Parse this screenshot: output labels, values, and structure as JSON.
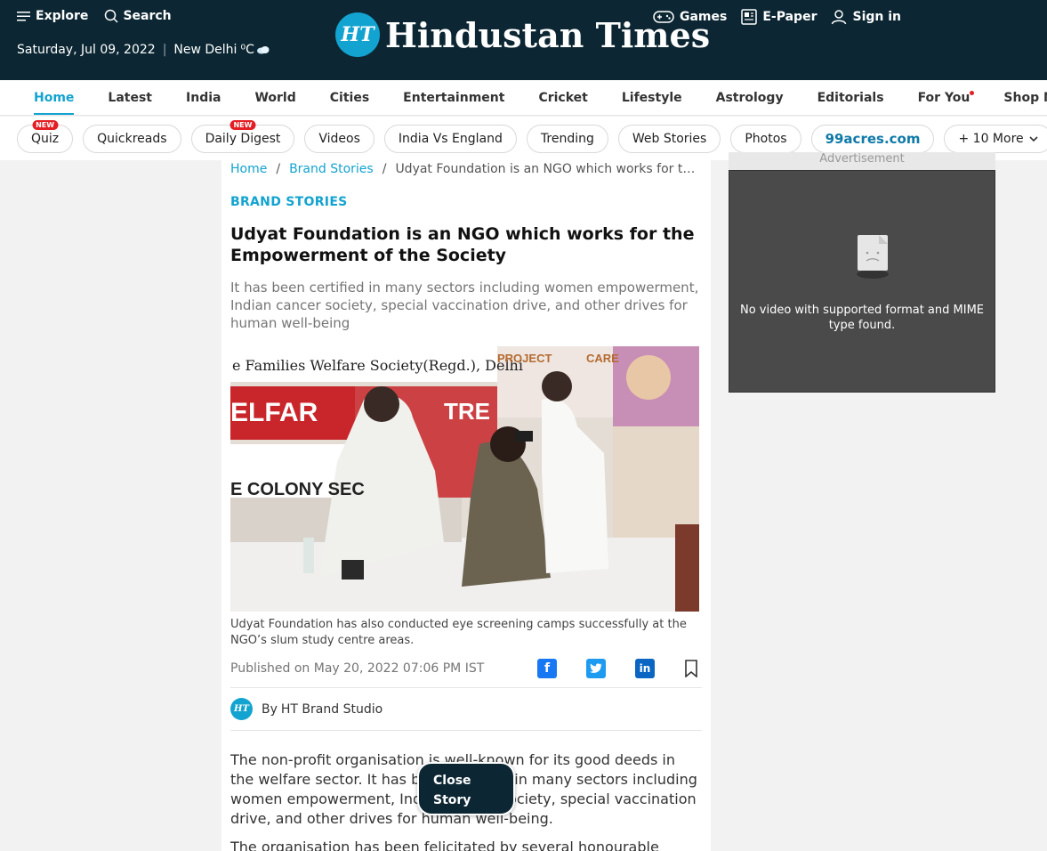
{
  "header": {
    "explore": "Explore",
    "search": "Search",
    "date": "Saturday, Jul 09, 2022",
    "city": "New Delhi",
    "temp": "⁰C",
    "logo_badge": "HT",
    "logo_text": "Hindustan Times",
    "games": "Games",
    "epaper": "E-Paper",
    "signin": "Sign in"
  },
  "nav": [
    "Home",
    "Latest",
    "India",
    "World",
    "Cities",
    "Entertainment",
    "Cricket",
    "Lifestyle",
    "Astrology",
    "Editorials",
    "For You",
    "Shop Now"
  ],
  "pills": {
    "new_tag": "NEW",
    "items": [
      "Quiz",
      "Quickreads",
      "Daily Digest",
      "Videos",
      "India Vs England",
      "Trending",
      "Web Stories",
      "Photos",
      "99acres.com",
      "+ 10 More"
    ]
  },
  "article": {
    "breadcrumb": [
      "Home",
      "Brand Stories",
      "Udyat Foundation is an NGO which works for the Empowerment of the Society"
    ],
    "section": "BRAND STORIES",
    "title": "Udyat Foundation is an NGO which works for the Empowerment of the Society",
    "summary": "It has been certified in many sectors including women empowerment, Indian cancer society, special vaccination drive, and other drives for human well-being",
    "image_banner_1": "e Families Welfare Society(Regd.), Delhi",
    "image_banner_2": "ELFAR",
    "image_banner_3": "TRE",
    "image_banner_4": "E COLONY SEC",
    "image_banner_5": "PROJECT",
    "image_banner_6": "CARE",
    "caption": "Udyat Foundation has also conducted eye screening camps successfully at the NGO’s slum study centre areas.",
    "published": "Published on May 20, 2022 07:06 PM IST",
    "by": "By",
    "author": "HT Brand Studio",
    "author_badge": "HT",
    "body": [
      "The non-profit organisation is well-known for its good deeds in the welfare sector. It has been certified in many sectors including women empowerment, Indian cancer society, special vaccination drive, and other drives for human well-being.",
      "The organisation has been felicitated by several honourable officials"
    ],
    "close_story": "Close Story"
  },
  "share": {
    "facebook": "f",
    "twitter": "t",
    "linkedin": "in"
  },
  "ad": {
    "label": "Advertisement",
    "message": "No video with supported format and MIME type found."
  },
  "colors": {
    "header_bg": "#0c2733",
    "accent": "#13a3d0",
    "new_badge": "#e31e24"
  }
}
